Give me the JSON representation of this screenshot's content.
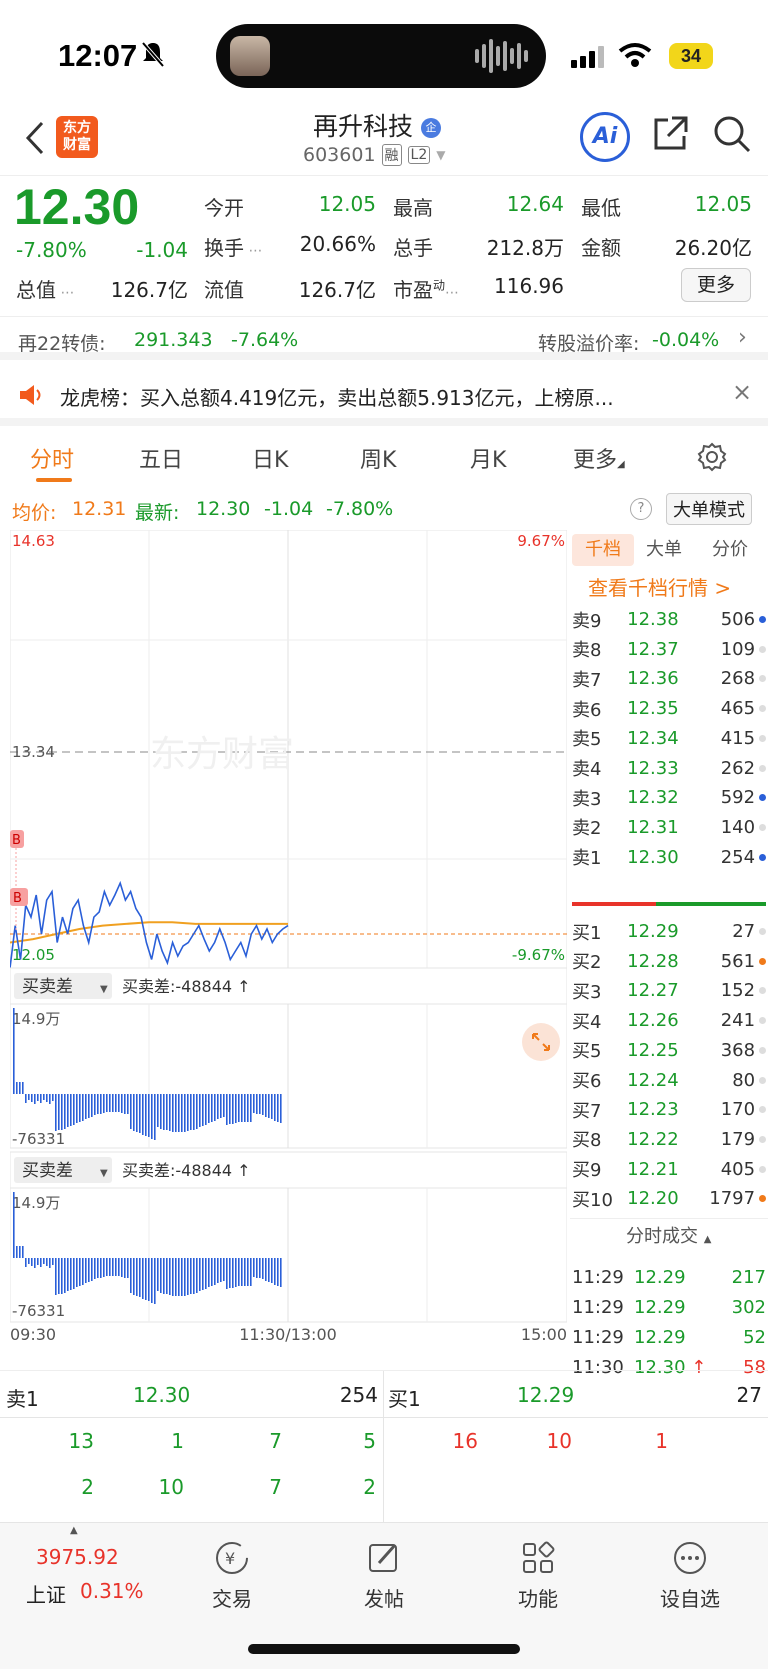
{
  "status": {
    "time": "12:07",
    "battery": "34"
  },
  "header": {
    "logo_line1": "东方",
    "logo_line2": "财富",
    "name": "再升科技",
    "name_badge": "企",
    "code": "603601",
    "tag1": "融",
    "tag2": "L2",
    "ai": "Ai"
  },
  "quote": {
    "price": "12.30",
    "chg_pct": "-7.80%",
    "chg": "-1.04",
    "open_label": "今开",
    "open": "12.05",
    "high_label": "最高",
    "high": "12.64",
    "low_label": "最低",
    "low": "12.05",
    "turn_label": "换手",
    "turn": "20.66%",
    "vol_label": "总手",
    "vol": "212.8万",
    "amt_label": "金额",
    "amt": "26.20亿",
    "mcap_label": "总值",
    "mcap": "126.7亿",
    "float_label": "流值",
    "float": "126.7亿",
    "pe_label": "市盈",
    "pe_sup": "动",
    "pe": "116.96",
    "more": "更多"
  },
  "bond": {
    "name": "再22转债:",
    "price": "291.343",
    "chg": "-7.64%",
    "premium_label": "转股溢价率:",
    "premium": "-0.04%"
  },
  "lhb": {
    "text": "龙虎榜：买入总额4.419亿元，卖出总额5.913亿元，上榜原..."
  },
  "tabs": [
    "分时",
    "五日",
    "日K",
    "周K",
    "月K",
    "更多"
  ],
  "avg": {
    "avg_label": "均价:",
    "avg": "12.31",
    "last_label": "最新:",
    "last": "12.30",
    "chg": "-1.04",
    "pct": "-7.80%",
    "mode": "大单模式"
  },
  "chart": {
    "top_price": "14.63",
    "top_pct": "9.67%",
    "mid_price": "13.34",
    "low_price": "12.05",
    "low_pct": "-9.67%",
    "watermark": "东方财富",
    "marker": "B",
    "sub1_select": "买卖差",
    "sub1_info": "买卖差:-48844 ↑",
    "sub_max": "14.9万",
    "sub_min": "-76331",
    "sub2_select": "买卖差",
    "sub2_info": "买卖差:-48844 ↑",
    "t_start": "09:30",
    "t_mid": "11:30/13:00",
    "t_end": "15:00"
  },
  "chart_data": {
    "type": "line",
    "ylim": [
      12.05,
      14.63
    ],
    "prev_close": "13.34",
    "x_range": [
      "09:30",
      "15:00"
    ]
  },
  "orderbook": {
    "tabs": [
      "千档",
      "大单",
      "分价"
    ],
    "link": "查看千档行情 >",
    "asks": [
      {
        "l": "卖9",
        "p": "12.38",
        "v": "506",
        "dot": "#2a5fd8"
      },
      {
        "l": "卖8",
        "p": "12.37",
        "v": "109",
        "dot": "#ddd"
      },
      {
        "l": "卖7",
        "p": "12.36",
        "v": "268",
        "dot": "#ddd"
      },
      {
        "l": "卖6",
        "p": "12.35",
        "v": "465",
        "dot": "#ddd"
      },
      {
        "l": "卖5",
        "p": "12.34",
        "v": "415",
        "dot": "#ddd"
      },
      {
        "l": "卖4",
        "p": "12.33",
        "v": "262",
        "dot": "#ddd"
      },
      {
        "l": "卖3",
        "p": "12.32",
        "v": "592",
        "dot": "#2a5fd8"
      },
      {
        "l": "卖2",
        "p": "12.31",
        "v": "140",
        "dot": "#ddd"
      },
      {
        "l": "卖1",
        "p": "12.30",
        "v": "254",
        "dot": "#2a5fd8"
      }
    ],
    "bids": [
      {
        "l": "买1",
        "p": "12.29",
        "v": "27",
        "dot": "#ddd"
      },
      {
        "l": "买2",
        "p": "12.28",
        "v": "561",
        "dot": "#f07a1a"
      },
      {
        "l": "买3",
        "p": "12.27",
        "v": "152",
        "dot": "#ddd"
      },
      {
        "l": "买4",
        "p": "12.26",
        "v": "241",
        "dot": "#ddd"
      },
      {
        "l": "买5",
        "p": "12.25",
        "v": "368",
        "dot": "#ddd"
      },
      {
        "l": "买6",
        "p": "12.24",
        "v": "80",
        "dot": "#ddd"
      },
      {
        "l": "买7",
        "p": "12.23",
        "v": "170",
        "dot": "#ddd"
      },
      {
        "l": "买8",
        "p": "12.22",
        "v": "179",
        "dot": "#ddd"
      },
      {
        "l": "买9",
        "p": "12.21",
        "v": "405",
        "dot": "#ddd"
      },
      {
        "l": "买10",
        "p": "12.20",
        "v": "1797",
        "dot": "#f07a1a"
      }
    ],
    "trades_label": "分时成交",
    "trades": [
      {
        "t": "11:29",
        "p": "12.29",
        "v": "217",
        "up": ""
      },
      {
        "t": "11:29",
        "p": "12.29",
        "v": "302",
        "up": ""
      },
      {
        "t": "11:29",
        "p": "12.29",
        "v": "52",
        "up": ""
      },
      {
        "t": "11:30",
        "p": "12.30",
        "v": "58",
        "up": "↑"
      }
    ]
  },
  "bottom": {
    "ask_label": "卖1",
    "ask_price": "12.30",
    "ask_vol": "254",
    "bid_label": "买1",
    "bid_price": "12.29",
    "bid_vol": "27",
    "ask_row1": [
      "13",
      "1",
      "7",
      "5"
    ],
    "ask_row2": [
      "2",
      "10",
      "7",
      "2"
    ],
    "bid_row1": [
      "16",
      "10",
      "1"
    ]
  },
  "tabbar": {
    "index_val": "3975.92",
    "index_name": "上证",
    "index_pct": "0.31%",
    "items": [
      "交易",
      "发帖",
      "功能",
      "设自选"
    ]
  }
}
